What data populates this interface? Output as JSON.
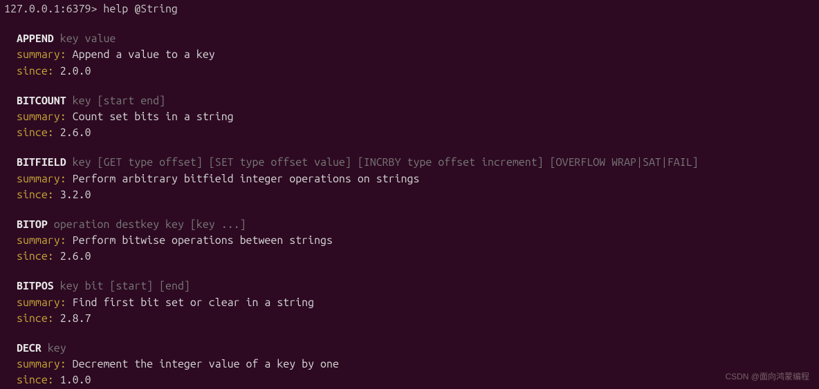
{
  "prompt": {
    "host": "127.0.0.1:6379>",
    "command": "help @String"
  },
  "commands": [
    {
      "name": "APPEND",
      "args": "key value",
      "summary": "Append a value to a key",
      "since": "2.0.0"
    },
    {
      "name": "BITCOUNT",
      "args": "key [start end]",
      "summary": "Count set bits in a string",
      "since": "2.6.0"
    },
    {
      "name": "BITFIELD",
      "args": "key [GET type offset] [SET type offset value] [INCRBY type offset increment] [OVERFLOW WRAP|SAT|FAIL]",
      "summary": "Perform arbitrary bitfield integer operations on strings",
      "since": "3.2.0"
    },
    {
      "name": "BITOP",
      "args": "operation destkey key [key ...]",
      "summary": "Perform bitwise operations between strings",
      "since": "2.6.0"
    },
    {
      "name": "BITPOS",
      "args": "key bit [start] [end]",
      "summary": "Find first bit set or clear in a string",
      "since": "2.8.7"
    },
    {
      "name": "DECR",
      "args": "key",
      "summary": "Decrement the integer value of a key by one",
      "since": "1.0.0"
    }
  ],
  "labels": {
    "summary": "summary:",
    "since": "since:"
  },
  "watermark": "CSDN @面向鸿蒙编程"
}
